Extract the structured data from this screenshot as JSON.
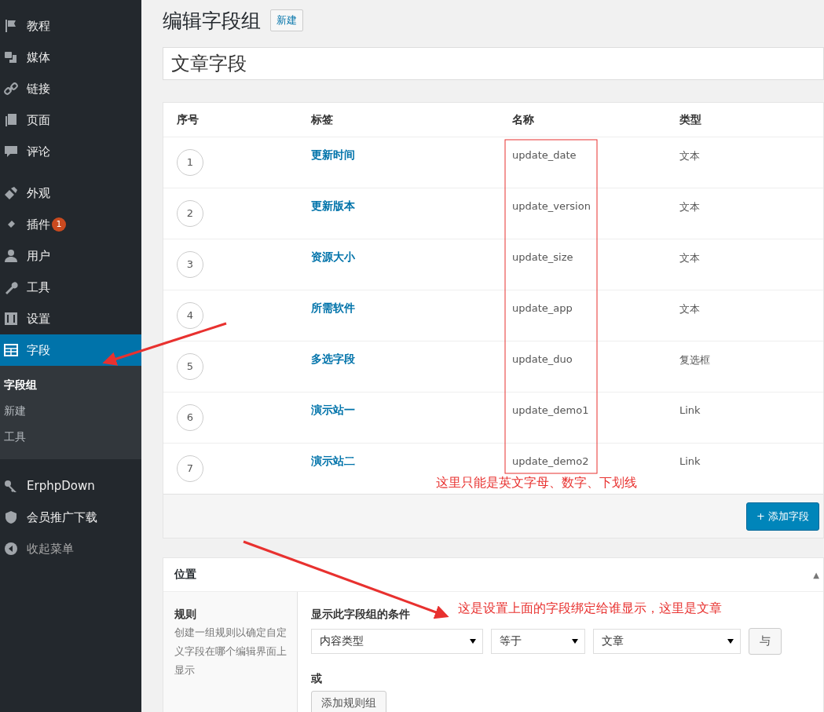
{
  "sidebar": {
    "items": [
      {
        "label": "教程",
        "selected": false
      },
      {
        "label": "媒体",
        "selected": false
      },
      {
        "label": "链接",
        "selected": false
      },
      {
        "label": "页面",
        "selected": false
      },
      {
        "label": "评论",
        "selected": false,
        "gap_after": true
      },
      {
        "label": "外观",
        "selected": false
      },
      {
        "label": "插件",
        "selected": false,
        "badge": "1"
      },
      {
        "label": "用户",
        "selected": false
      },
      {
        "label": "工具",
        "selected": false
      },
      {
        "label": "设置",
        "selected": false
      },
      {
        "label": "字段",
        "selected": true,
        "submenu": [
          {
            "label": "字段组",
            "selected": true
          },
          {
            "label": "新建",
            "selected": false
          },
          {
            "label": "工具",
            "selected": false
          }
        ]
      },
      {
        "label": "ErphpDown",
        "selected": false
      },
      {
        "label": "会员推广下载",
        "selected": false
      },
      {
        "label": "收起菜单",
        "selected": false,
        "kind": "collapse"
      }
    ]
  },
  "page": {
    "title": "编辑字段组",
    "new_button": "新建",
    "group_title": "文章字段"
  },
  "fields": {
    "columns": [
      "序号",
      "标签",
      "名称",
      "类型"
    ],
    "rows": [
      {
        "order": "1",
        "label": "更新时间",
        "name": "update_date",
        "type": "文本"
      },
      {
        "order": "2",
        "label": "更新版本",
        "name": "update_version",
        "type": "文本"
      },
      {
        "order": "3",
        "label": "资源大小",
        "name": "update_size",
        "type": "文本"
      },
      {
        "order": "4",
        "label": "所需软件",
        "name": "update_app",
        "type": "文本"
      },
      {
        "order": "5",
        "label": "多选字段",
        "name": "update_duo",
        "type": "复选框"
      },
      {
        "order": "6",
        "label": "演示站一",
        "name": "update_demo1",
        "type": "Link"
      },
      {
        "order": "7",
        "label": "演示站二",
        "name": "update_demo2",
        "type": "Link"
      }
    ],
    "add_button": "+ 添加字段"
  },
  "location": {
    "title": "位置",
    "toggle": "▲",
    "rules_title": "规则",
    "rules_description": "创建一组规则以确定自定义字段在哪个编辑界面上显示",
    "conditions_title": "显示此字段组的条件",
    "rule": {
      "param": "内容类型",
      "operator": "等于",
      "value": "文章",
      "and_button": "与"
    },
    "or_label": "或",
    "add_group_button": "添加规则组"
  },
  "annotations": [
    {
      "text": "这里只能是英文字母、数字、下划线"
    },
    {
      "text": "这是设置上面的字段绑定给谁显示，这里是文章"
    }
  ]
}
